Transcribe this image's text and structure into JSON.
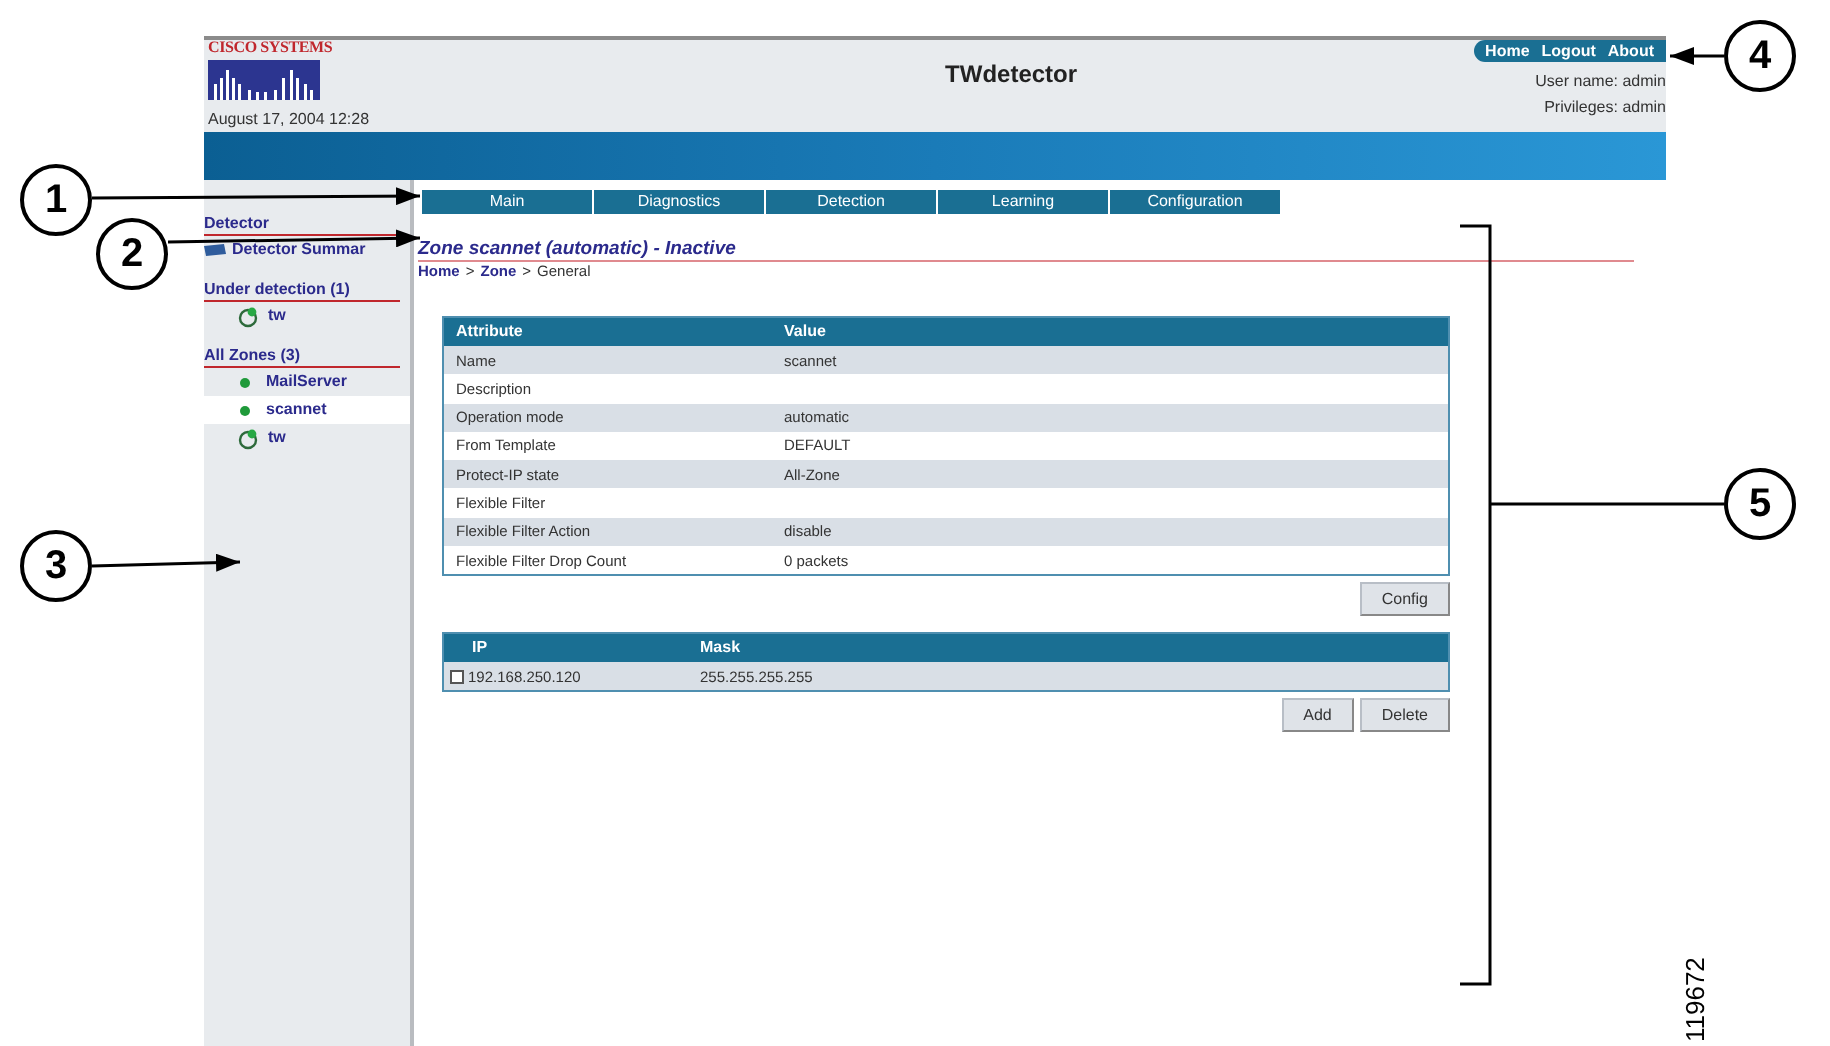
{
  "header": {
    "logo_text": "CISCO SYSTEMS",
    "date": "August 17, 2004 12:28",
    "title": "TWdetector",
    "links": [
      "Home",
      "Logout",
      "About"
    ],
    "user_name": "User name: admin",
    "privileges": "Privileges: admin"
  },
  "nav_tabs": [
    {
      "label": "Main",
      "selected": false
    },
    {
      "label": "Diagnostics",
      "selected": false
    },
    {
      "label": "Detection",
      "selected": false
    },
    {
      "label": "Learning",
      "selected": false
    },
    {
      "label": "Configuration",
      "selected": false
    }
  ],
  "sidebar": {
    "sections": [
      {
        "heading": "Detector",
        "items": [
          {
            "label": "Detector Summar",
            "kind": "summary",
            "selected": false
          }
        ]
      },
      {
        "heading": "Under detection (1)",
        "items": [
          {
            "label": "tw",
            "kind": "detecting",
            "selected": false
          }
        ]
      },
      {
        "heading": "All Zones (3)",
        "items": [
          {
            "label": "MailServer",
            "kind": "zone",
            "selected": false
          },
          {
            "label": "scannet",
            "kind": "zone",
            "selected": true
          },
          {
            "label": "tw",
            "kind": "detecting",
            "selected": false
          }
        ]
      }
    ]
  },
  "page": {
    "title": "Zone scannet (automatic) - Inactive",
    "breadcrumb": [
      {
        "label": "Home",
        "link": true
      },
      {
        "label": ">",
        "link": false
      },
      {
        "label": "Zone",
        "link": true
      },
      {
        "label": ">",
        "link": false
      },
      {
        "label": "General",
        "link": false
      }
    ]
  },
  "attributes_table": {
    "columns": [
      "Attribute",
      "Value"
    ],
    "rows": [
      [
        "Name",
        "scannet"
      ],
      [
        "Description",
        ""
      ],
      [
        "Operation mode",
        "automatic"
      ],
      [
        "From Template",
        "DEFAULT"
      ],
      [
        "Protect-IP state",
        "All-Zone"
      ],
      [
        "Flexible Filter",
        ""
      ],
      [
        "Flexible Filter Action",
        "disable"
      ],
      [
        "Flexible Filter Drop Count",
        "0 packets"
      ]
    ],
    "button": "Config"
  },
  "ip_table": {
    "columns": [
      "IP",
      "Mask"
    ],
    "rows": [
      {
        "ip": "192.168.250.120",
        "mask": "255.255.255.255",
        "checked": false
      }
    ],
    "buttons": [
      "Add",
      "Delete"
    ]
  },
  "callouts": [
    {
      "label": "1"
    },
    {
      "label": "2"
    },
    {
      "label": "3"
    },
    {
      "label": "4"
    },
    {
      "label": "5"
    }
  ],
  "figure_number": "119672"
}
